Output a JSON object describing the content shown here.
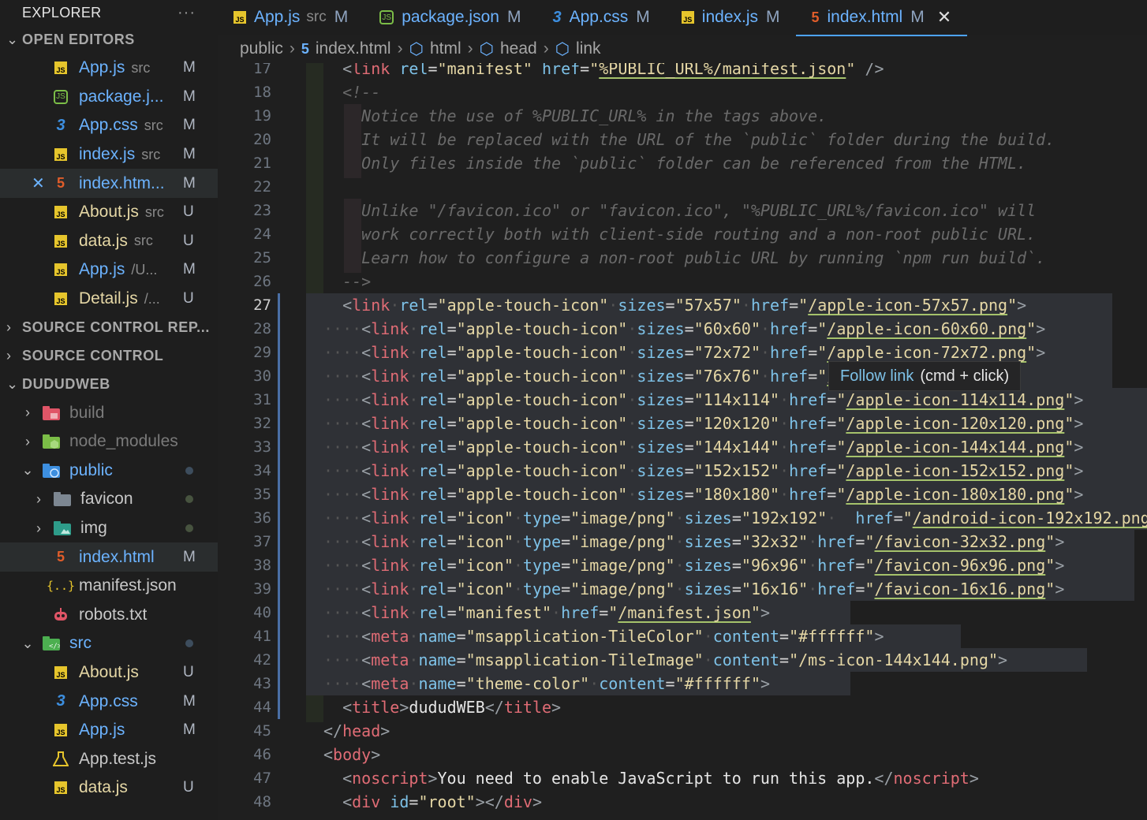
{
  "sidebar": {
    "title": "EXPLORER",
    "more": "···",
    "open_editors": {
      "label": "OPEN EDITORS",
      "items": [
        {
          "icon": "js",
          "name": "App.js",
          "sub": "src",
          "badge": "M"
        },
        {
          "icon": "node",
          "name": "package.j...",
          "sub": "",
          "badge": "M"
        },
        {
          "icon": "css",
          "name": "App.css",
          "sub": "src",
          "badge": "M"
        },
        {
          "icon": "js",
          "name": "index.js",
          "sub": "src",
          "badge": "M"
        },
        {
          "icon": "html",
          "name": "index.htm...",
          "sub": "",
          "badge": "M"
        },
        {
          "icon": "js",
          "name": "About.js",
          "sub": "src",
          "badge": "U"
        },
        {
          "icon": "js",
          "name": "data.js",
          "sub": "src",
          "badge": "U"
        },
        {
          "icon": "js",
          "name": "App.js",
          "sub": "/U...",
          "badge": "M"
        },
        {
          "icon": "js",
          "name": "Detail.js",
          "sub": "/...",
          "badge": "U"
        }
      ]
    },
    "source_control_rep": "SOURCE CONTROL REP...",
    "source_control": "SOURCE CONTROL",
    "workspace": {
      "label": "DUDUDWEB",
      "items": [
        {
          "name": "build"
        },
        {
          "name": "node_modules"
        },
        {
          "name": "public"
        },
        {
          "name": "favicon"
        },
        {
          "name": "img"
        },
        {
          "name": "index.html",
          "badge": "M"
        },
        {
          "name": "manifest.json"
        },
        {
          "name": "robots.txt"
        },
        {
          "name": "src"
        },
        {
          "name": "About.js",
          "badge": "U"
        },
        {
          "name": "App.css",
          "badge": "M"
        },
        {
          "name": "App.js",
          "badge": "M"
        },
        {
          "name": "App.test.js"
        },
        {
          "name": "data.js",
          "badge": "U"
        }
      ]
    }
  },
  "tabs": [
    {
      "icon": "js",
      "name": "App.js",
      "sub": "src",
      "badge": "M"
    },
    {
      "icon": "node",
      "name": "package.json",
      "sub": "",
      "badge": "M"
    },
    {
      "icon": "css",
      "name": "App.css",
      "sub": "",
      "badge": "M"
    },
    {
      "icon": "js",
      "name": "index.js",
      "sub": "",
      "badge": "M"
    },
    {
      "icon": "html",
      "name": "index.html",
      "sub": "",
      "badge": "M",
      "close": "✕"
    }
  ],
  "breadcrumb": [
    "public",
    "index.html",
    "html",
    "head",
    "link"
  ],
  "tooltip": {
    "link": "Follow link",
    "hint": "(cmd + click)"
  },
  "editor": {
    "line_numbers": [
      "17",
      "18",
      "19",
      "20",
      "21",
      "22",
      "23",
      "24",
      "25",
      "26",
      "27",
      "28",
      "29",
      "30",
      "31",
      "32",
      "33",
      "34",
      "35",
      "36",
      "37",
      "38",
      "39",
      "40",
      "41",
      "42",
      "43",
      "44",
      "45",
      "46",
      "47",
      "48"
    ],
    "comment_lines": [
      "Notice the use of %PUBLIC_URL% in the tags above.",
      "It will be replaced with the URL of the `public` folder during the build.",
      "Only files inside the `public` folder can be referenced from the HTML.",
      "Unlike \"/favicon.ico\" or \"favicon.ico\", \"%PUBLIC_URL%/favicon.ico\" will",
      "work correctly both with client-side routing and a non-root public URL.",
      "Learn how to configure a non-root public URL by running `npm run build`."
    ],
    "apple_icons": [
      {
        "sizes": "57x57",
        "href": "/apple-icon-57x57.png"
      },
      {
        "sizes": "60x60",
        "href": "/apple-icon-60x60.png"
      },
      {
        "sizes": "72x72",
        "href": "/apple-icon-72x72.png"
      },
      {
        "sizes": "76x76",
        "href": "/a"
      },
      {
        "sizes": "114x114",
        "href": "/apple-icon-114x114.png"
      },
      {
        "sizes": "120x120",
        "href": "/apple-icon-120x120.png"
      },
      {
        "sizes": "144x144",
        "href": "/apple-icon-144x144.png"
      },
      {
        "sizes": "152x152",
        "href": "/apple-icon-152x152.png"
      },
      {
        "sizes": "180x180",
        "href": "/apple-icon-180x180.png"
      }
    ],
    "icons": [
      {
        "sizes": "192x192",
        "href": "/android-icon-192x192.png"
      },
      {
        "sizes": "32x32",
        "href": "/favicon-32x32.png"
      },
      {
        "sizes": "96x96",
        "href": "/favicon-96x96.png"
      },
      {
        "sizes": "16x16",
        "href": "/favicon-16x16.png"
      }
    ],
    "manifest_top": "%PUBLIC_URL%/manifest.json",
    "manifest_href": "/manifest.json",
    "tile_color": "#ffffff",
    "tile_image": "/ms-icon-144x144.png",
    "theme_color": "#ffffff",
    "title_text": "dududWEB",
    "noscript_text": "You need to enable JavaScript to run this app.",
    "root_id": "root"
  }
}
